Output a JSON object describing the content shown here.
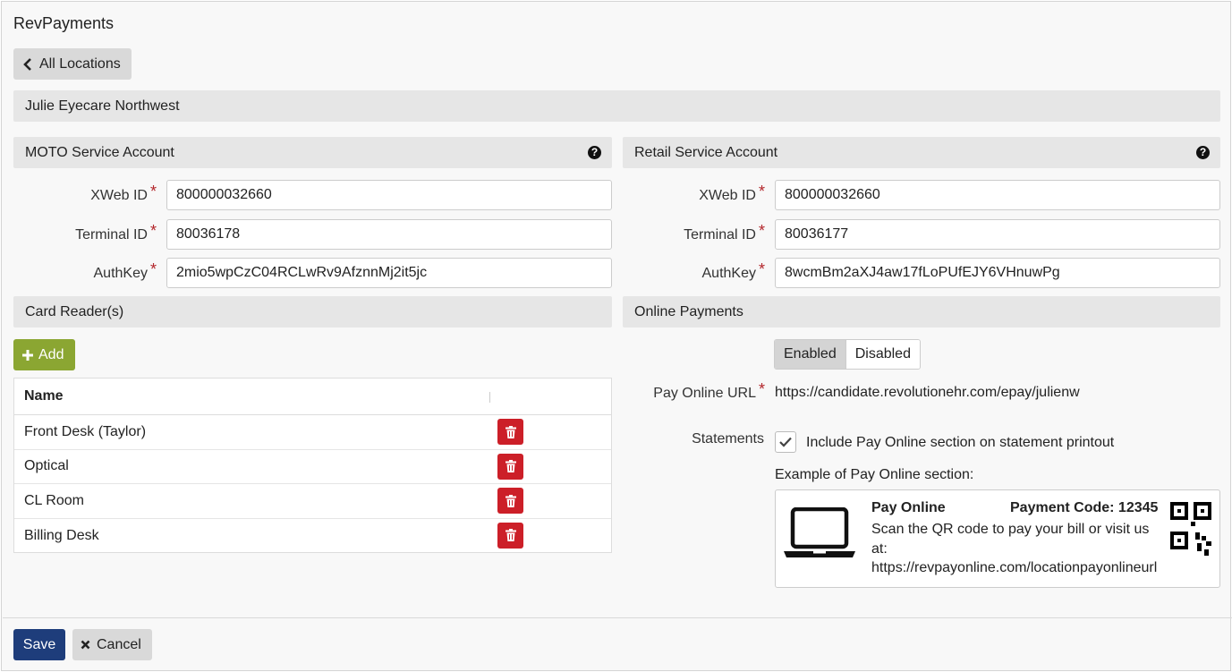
{
  "app": {
    "title": "RevPayments"
  },
  "nav": {
    "back_label": "All Locations"
  },
  "location": {
    "name": "Julie Eyecare Northwest"
  },
  "moto": {
    "title": "MOTO Service Account",
    "xweb_label": "XWeb ID",
    "xweb_value": "800000032660",
    "terminal_label": "Terminal ID",
    "terminal_value": "80036178",
    "authkey_label": "AuthKey",
    "authkey_value": "2mio5wpCzC04RCLwRv9AfznnMj2it5jc"
  },
  "retail": {
    "title": "Retail Service Account",
    "xweb_label": "XWeb ID",
    "xweb_value": "800000032660",
    "terminal_label": "Terminal ID",
    "terminal_value": "80036177",
    "authkey_label": "AuthKey",
    "authkey_value": "8wcmBm2aXJ4aw17fLoPUfEJY6VHnuwPg"
  },
  "card_readers": {
    "title": "Card Reader(s)",
    "add_label": "Add",
    "column_name": "Name",
    "rows": [
      {
        "name": "Front Desk (Taylor)"
      },
      {
        "name": "Optical"
      },
      {
        "name": "CL Room"
      },
      {
        "name": "Billing Desk"
      }
    ]
  },
  "online": {
    "title": "Online Payments",
    "enabled_label": "Enabled",
    "disabled_label": "Disabled",
    "selected": "Enabled",
    "url_label": "Pay Online URL",
    "url_value": "https://candidate.revolutionehr.com/epay/julienw",
    "statements_label": "Statements",
    "include_label": "Include Pay Online section on statement printout",
    "include_checked": true,
    "example_label": "Example of Pay Online section:",
    "example": {
      "heading": "Pay Online",
      "payment_code": "Payment Code: 12345",
      "body": "Scan the QR code to pay your bill or visit us at:",
      "url": "https://revpayonline.com/locationpayonlineurl"
    }
  },
  "footer": {
    "save_label": "Save",
    "cancel_label": "Cancel"
  },
  "colors": {
    "required": "#b3262b",
    "primary": "#1e3d7b",
    "success": "#8ba632",
    "danger": "#cc1f28"
  }
}
